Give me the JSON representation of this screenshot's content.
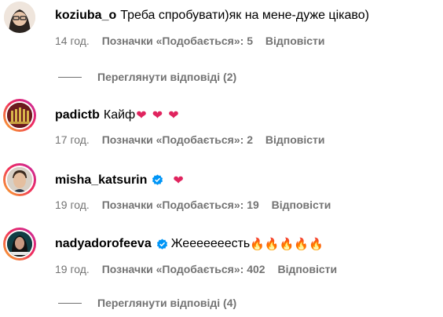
{
  "comments": [
    {
      "username": "koziuba_o",
      "text": "Треба спробувати)як на мене-дуже цікаво)",
      "time": "14 год.",
      "likes": "Позначки «Подобається»: 5",
      "reply": "Відповісти",
      "view_replies": "Переглянути відповіді (2)"
    },
    {
      "username": "padictb",
      "text": "Кайф",
      "emojis": "❤ ❤ ❤",
      "time": "17 год.",
      "likes": "Позначки «Подобається»: 2",
      "reply": "Відповісти"
    },
    {
      "username": "misha_katsurin",
      "text": "",
      "emojis": "❤",
      "time": "19 год.",
      "likes": "Позначки «Подобається»: 19",
      "reply": "Відповісти"
    },
    {
      "username": "nadyadorofeeva",
      "text": "Жееееееесть",
      "emojis": "🔥🔥🔥🔥🔥",
      "time": "19 год.",
      "likes": "Позначки «Подобається»: 402",
      "reply": "Відповісти",
      "view_replies": "Переглянути відповіді (4)"
    }
  ],
  "colors": {
    "meta": "#737373",
    "verified": "#0095f6",
    "story_ring": "#ee2a5f"
  }
}
